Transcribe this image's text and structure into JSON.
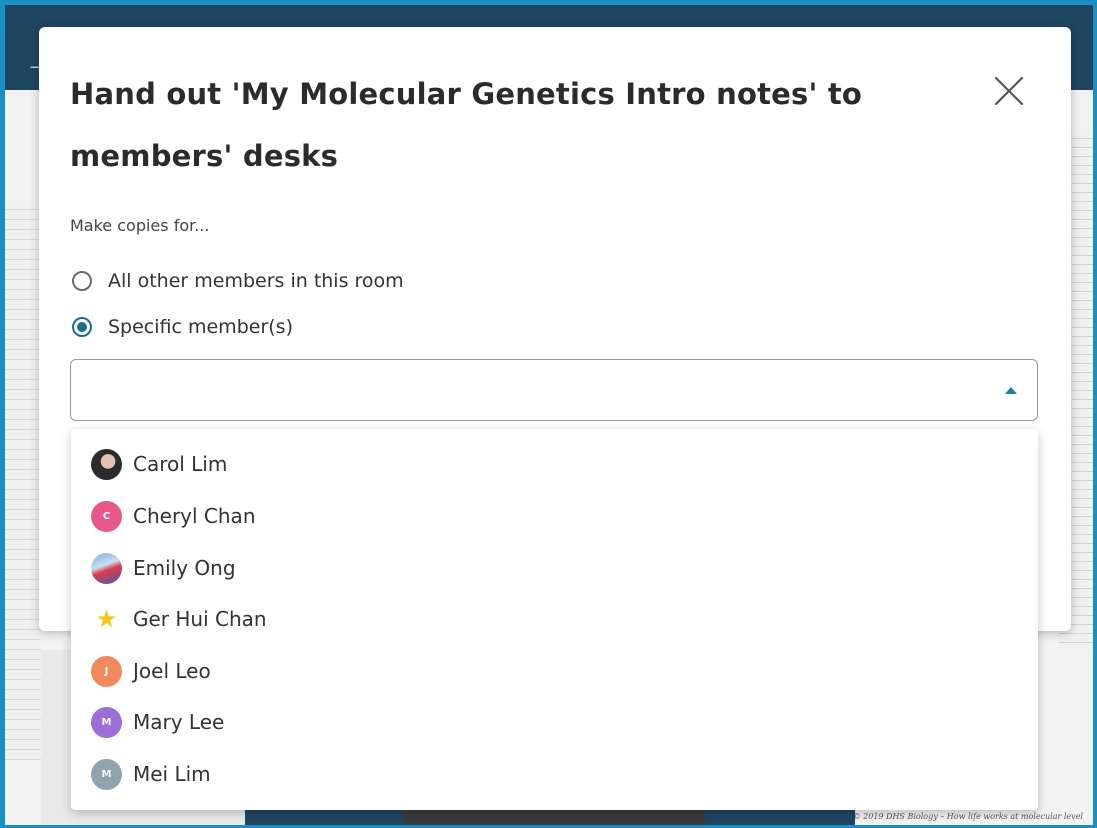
{
  "dialog": {
    "title": "Hand out 'My Molecular Genetics Intro notes' to members' desks",
    "prompt": "Make copies for...",
    "options": [
      {
        "label": "All other members in this room",
        "checked": false
      },
      {
        "label": "Specific member(s)",
        "checked": true
      }
    ],
    "select_value": ""
  },
  "members": [
    {
      "name": "Carol Lim",
      "avatar": "photo",
      "initial": ""
    },
    {
      "name": "Cheryl Chan",
      "avatar": "initial",
      "initial": "C",
      "color": "#e8588a"
    },
    {
      "name": "Emily Ong",
      "avatar": "photo",
      "initial": ""
    },
    {
      "name": "Ger Hui Chan",
      "avatar": "star-icon",
      "initial": "★",
      "color": "#f0c419"
    },
    {
      "name": "Joel Leo",
      "avatar": "initial",
      "initial": "J",
      "color": "#f08a5d"
    },
    {
      "name": "Mary Lee",
      "avatar": "initial",
      "initial": "M",
      "color": "#9b6fd6"
    },
    {
      "name": "Mei Lim",
      "avatar": "initial",
      "initial": "M",
      "color": "#90a4b0"
    }
  ],
  "background": {
    "footer": "© 2019 DHS Biology – How life works at molecular level"
  },
  "colors": {
    "accent": "#1b6e8c",
    "caret": "#1b7fa3",
    "frame": "#1a8fc4",
    "app_bar": "#1f4560"
  }
}
